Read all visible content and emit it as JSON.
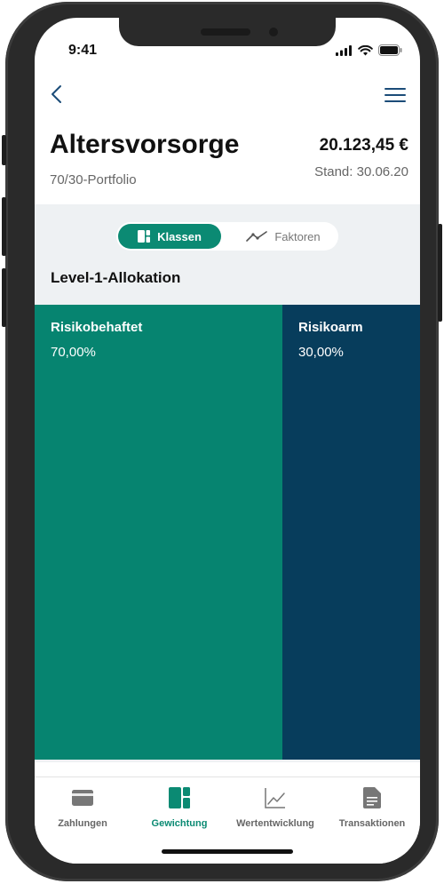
{
  "status": {
    "time": "9:41"
  },
  "header": {
    "title": "Altersvorsorge",
    "subtitle": "70/30-Portfolio",
    "amount": "20.123,45 €",
    "date": "Stand: 30.06.20"
  },
  "segmented": {
    "active_label": "Klassen",
    "inactive_label": "Faktoren"
  },
  "section": {
    "title": "Level-1-Allokation"
  },
  "allocation": [
    {
      "name": "Risikobehaftet",
      "percent": "70,00%",
      "color": "#068470"
    },
    {
      "name": "Risikoarm",
      "percent": "30,00%",
      "color": "#073d5c"
    }
  ],
  "tabs": [
    {
      "label": "Zahlungen",
      "icon": "card-icon",
      "active": false
    },
    {
      "label": "Gewichtung",
      "icon": "allocation-icon",
      "active": true
    },
    {
      "label": "Wertentwicklung",
      "icon": "line-chart-icon",
      "active": false
    },
    {
      "label": "Transaktionen",
      "icon": "document-icon",
      "active": false
    }
  ],
  "colors": {
    "accent": "#0b8a73",
    "navy": "#073d5c",
    "panel": "#eef1f3"
  }
}
